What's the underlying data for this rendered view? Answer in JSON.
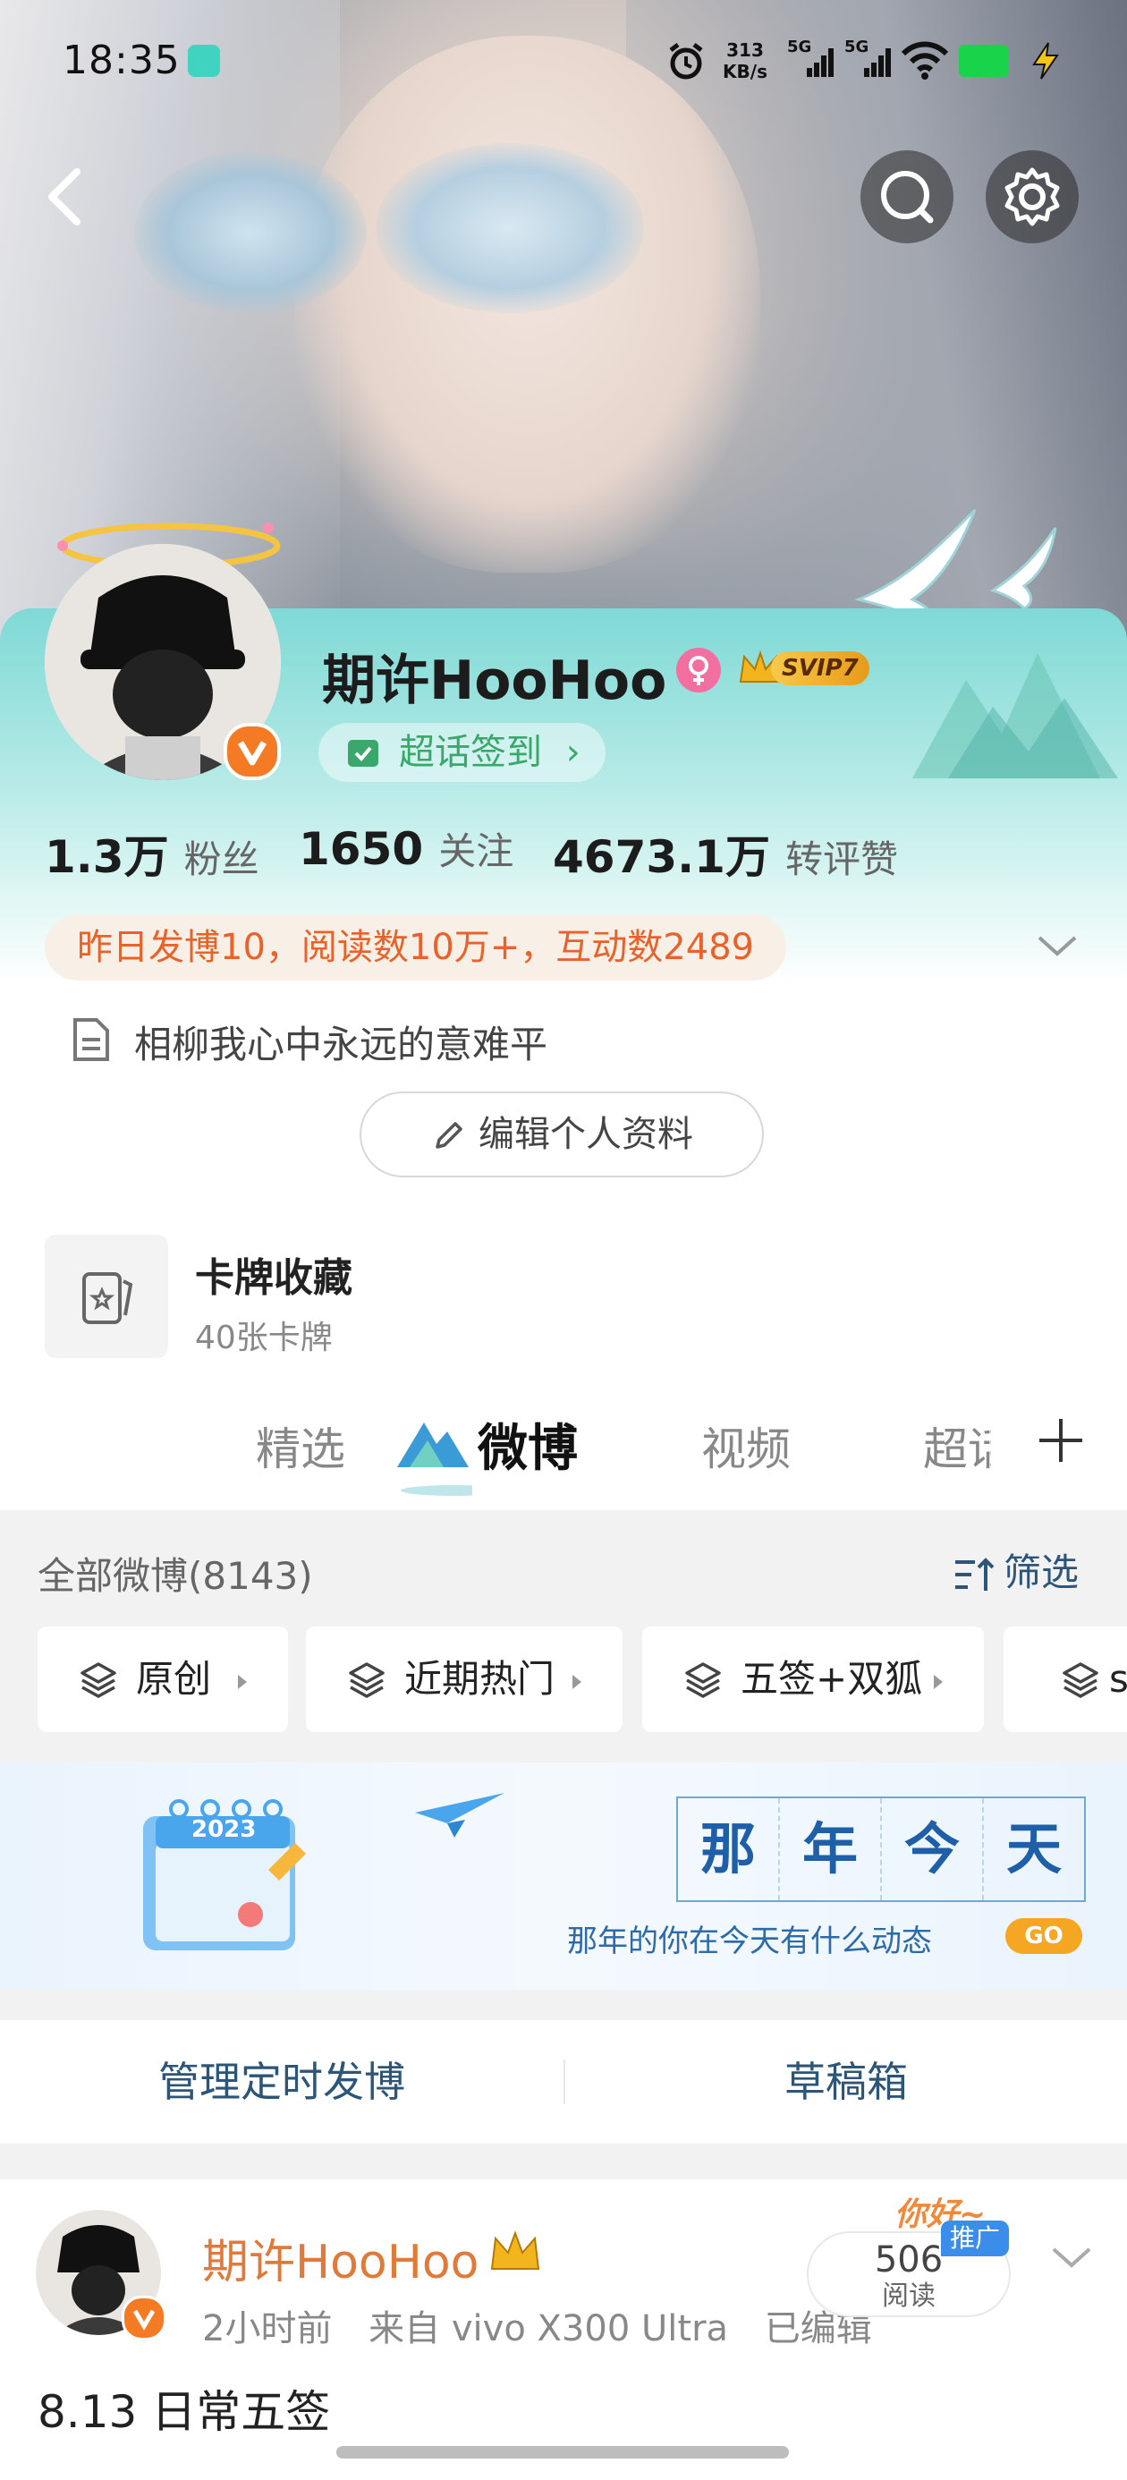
{
  "status_bar": {
    "time": "18:35",
    "speed_value": "313",
    "speed_unit": "KB/s",
    "net1": "5G",
    "net2": "5G"
  },
  "profile": {
    "name": "期许HooHoo",
    "svip": "SVIP7",
    "supertopic_checkin": "超话签到",
    "stats": [
      {
        "value": "1.3万",
        "label": "粉丝"
      },
      {
        "value": "1650",
        "label": "关注"
      },
      {
        "value": "4673.1万",
        "label": "转评赞"
      }
    ],
    "summary": "昨日发博10，阅读数10万+，互动数2489",
    "bio": "相柳我心中永远的意难平",
    "edit_label": "编辑个人资料"
  },
  "cards": {
    "title": "卡牌收藏",
    "subtitle": "40张卡牌"
  },
  "tabs": [
    {
      "label": "精选"
    },
    {
      "label": "微博"
    },
    {
      "label": "视频"
    },
    {
      "label": "超话"
    }
  ],
  "feed_header": {
    "all_posts": "全部微博(8143)",
    "filter_label": "筛选"
  },
  "filter_pills": [
    {
      "label": "原创"
    },
    {
      "label": "近期热门"
    },
    {
      "label": "五签+双狐"
    },
    {
      "label": "s"
    }
  ],
  "banner": {
    "chars": [
      "那",
      "年",
      "今",
      "天"
    ],
    "tagline": "那年的你在今天有什么动态",
    "go": "GO",
    "calendar_year": "2023"
  },
  "actions": {
    "scheduled": "管理定时发博",
    "drafts": "草稿箱"
  },
  "post": {
    "author": "期许HooHoo",
    "time": "2小时前",
    "source": "来自 vivo X300 Ultra",
    "edited": "已编辑",
    "reads_value": "506",
    "reads_label": "阅读",
    "promo_badge": "推广",
    "sticker_text": "你好~",
    "text": "8.13 日常五签"
  },
  "colors": {
    "accent_orange": "#e07a3a",
    "panel_teal": "#7fd9d6",
    "link_blue": "#2c5578",
    "go_yellow": "#f5a623"
  }
}
